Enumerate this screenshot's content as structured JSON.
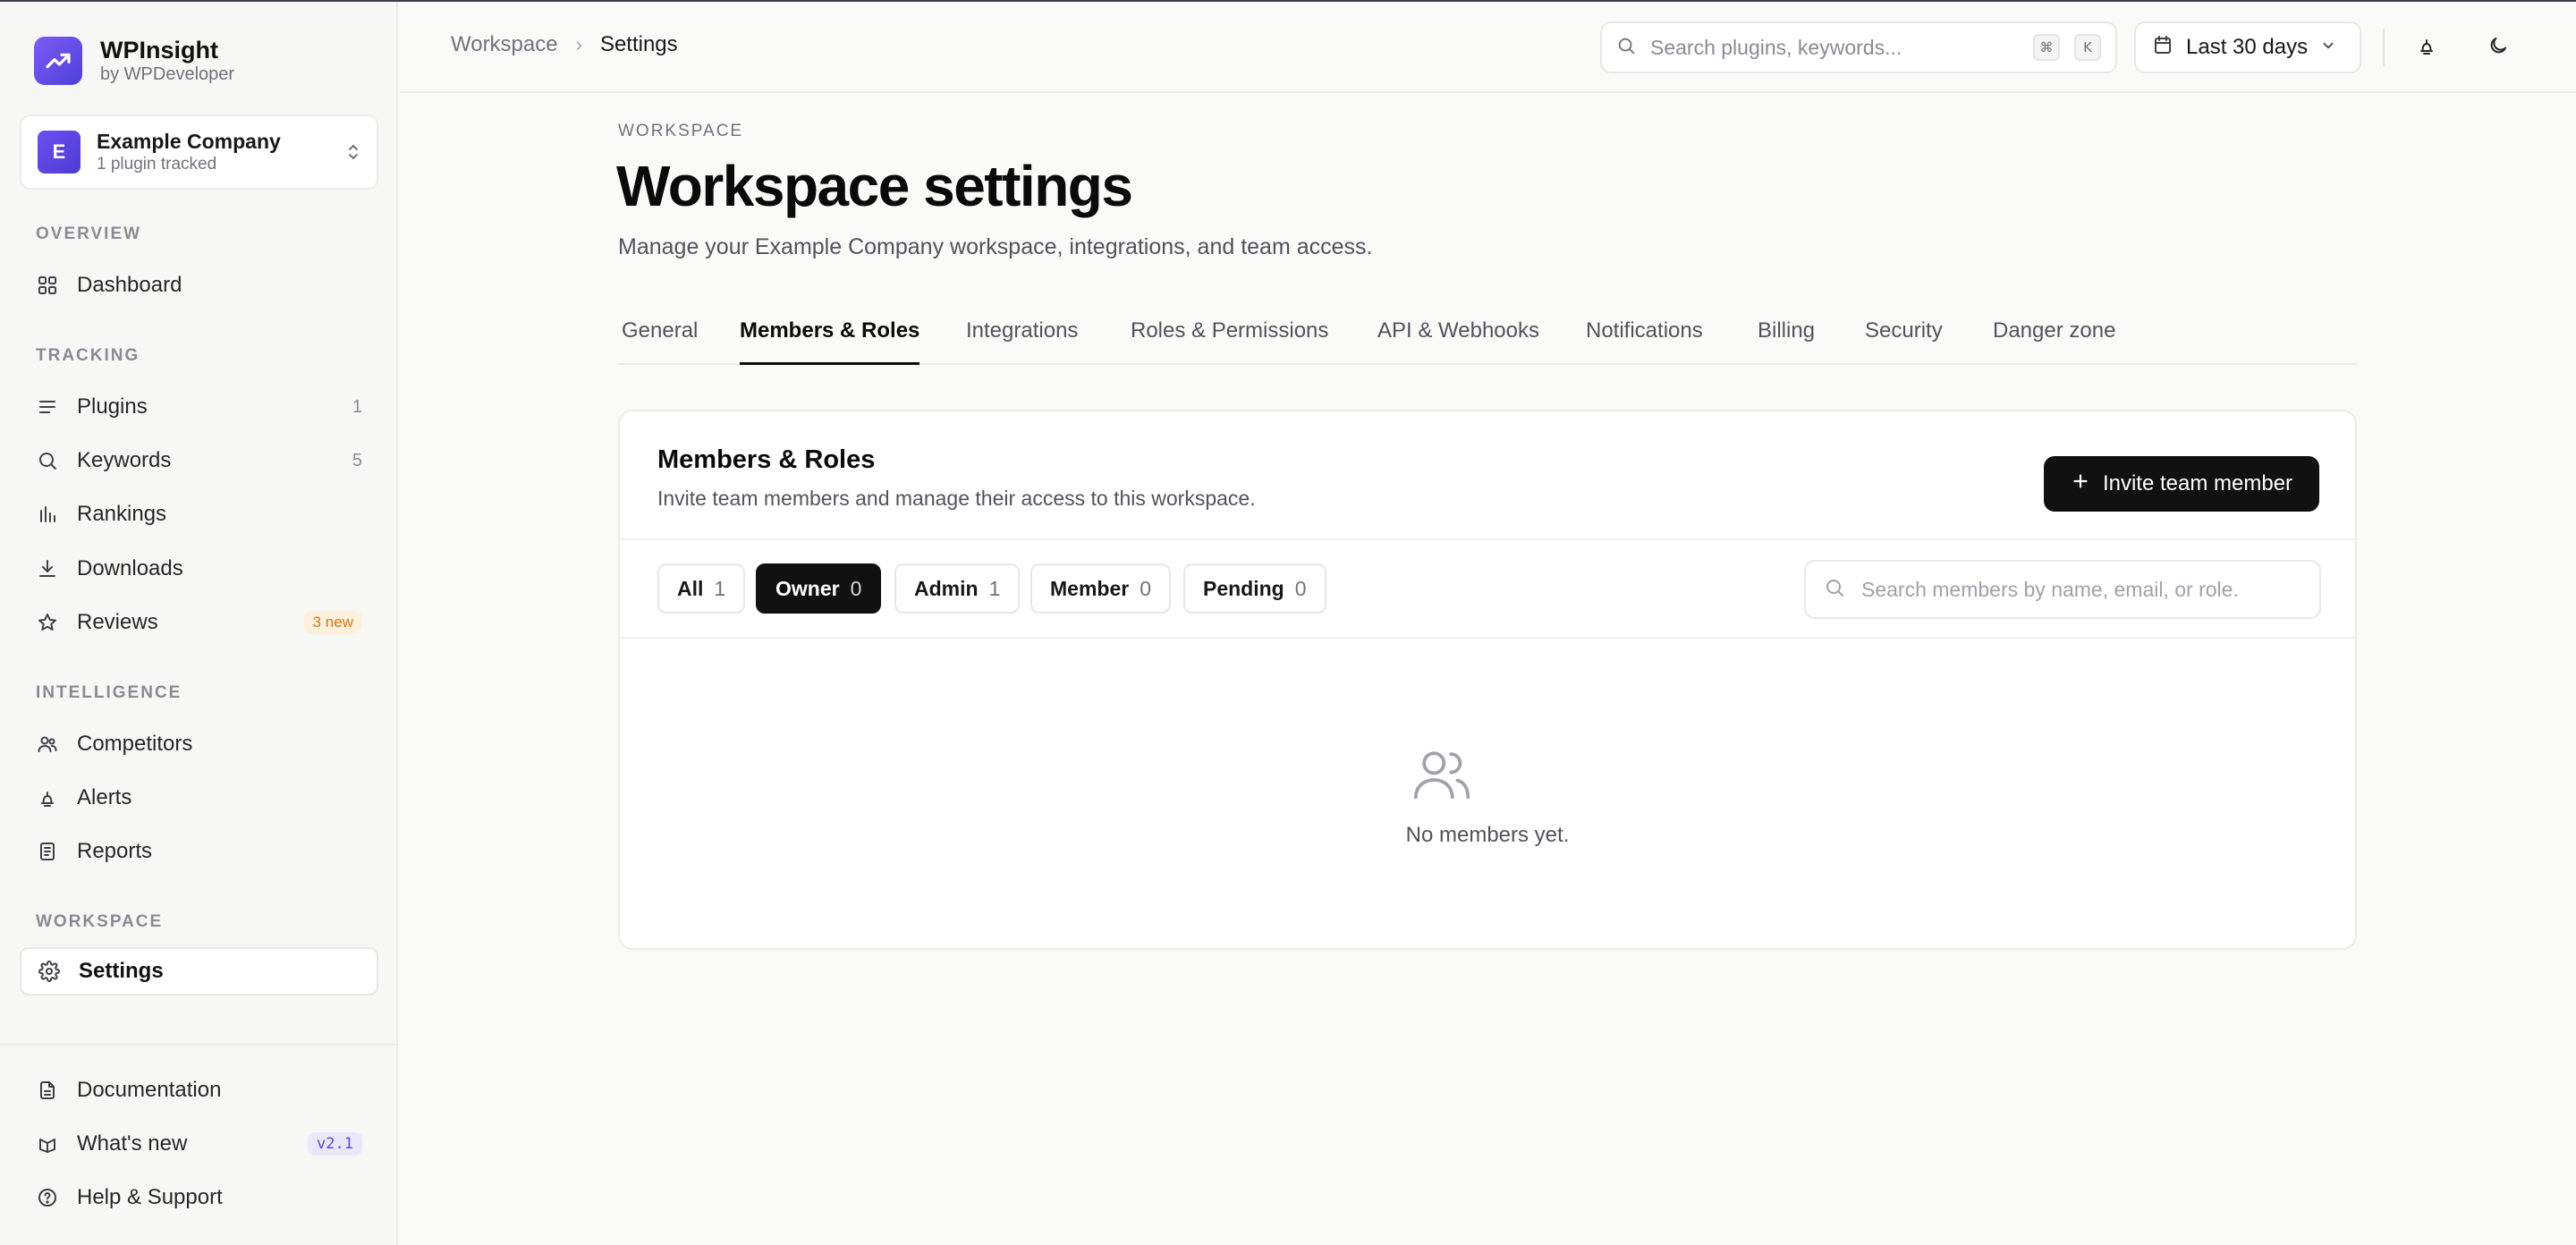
{
  "brand": {
    "name": "WPInsight",
    "by": "by WPDeveloper"
  },
  "company": {
    "avatar_letter": "E",
    "name": "Example Company",
    "subtitle": "1 plugin tracked"
  },
  "sidebar": {
    "overview_label": "OVERVIEW",
    "tracking_label": "TRACKING",
    "intelligence_label": "INTELLIGENCE",
    "workspace_label": "WORKSPACE",
    "items": [
      {
        "label": "Dashboard",
        "icon": "grid-icon"
      },
      {
        "label": "Plugins",
        "icon": "list-icon",
        "count": "1"
      },
      {
        "label": "Keywords",
        "icon": "search-icon",
        "count": "5"
      },
      {
        "label": "Rankings",
        "icon": "bar-chart-icon"
      },
      {
        "label": "Downloads",
        "icon": "download-icon"
      },
      {
        "label": "Reviews",
        "icon": "star-icon",
        "badge": "3 new"
      },
      {
        "label": "Competitors",
        "icon": "users-icon"
      },
      {
        "label": "Alerts",
        "icon": "bell-icon"
      },
      {
        "label": "Reports",
        "icon": "report-icon"
      },
      {
        "label": "Settings",
        "icon": "gear-icon"
      }
    ],
    "footer": [
      {
        "label": "Documentation",
        "icon": "document-icon"
      },
      {
        "label": "What's new",
        "icon": "gift-icon",
        "badge": "v2.1"
      },
      {
        "label": "Help & Support",
        "icon": "help-icon"
      }
    ]
  },
  "header": {
    "breadcrumb": [
      "Workspace",
      "Settings"
    ],
    "search_placeholder": "Search plugins, keywords...",
    "kbd": [
      "⌘",
      "K"
    ],
    "date_range": "Last 30 days"
  },
  "page": {
    "eyebrow": "WORKSPACE",
    "title": "Workspace settings",
    "subtitle": "Manage your Example Company workspace, integrations, and team access.",
    "tabs": [
      "General",
      "Members & Roles",
      "Integrations",
      "Roles & Permissions",
      "API & Webhooks",
      "Notifications",
      "Billing",
      "Security",
      "Danger zone"
    ],
    "active_tab": "Members & Roles"
  },
  "members": {
    "title": "Members & Roles",
    "subtitle": "Invite team members and manage their access to this workspace.",
    "invite_label": "Invite team member",
    "filters": [
      {
        "label": "All",
        "count": "1"
      },
      {
        "label": "Owner",
        "count": "0"
      },
      {
        "label": "Admin",
        "count": "1"
      },
      {
        "label": "Member",
        "count": "0"
      },
      {
        "label": "Pending",
        "count": "0"
      }
    ],
    "active_filter": "Owner",
    "search_placeholder": "Search members by name, email, or role.",
    "empty_text": "No members yet."
  },
  "colors": {
    "accent": "#5b46d6",
    "primary_button": "#111111",
    "badge_new": "#d97706"
  }
}
